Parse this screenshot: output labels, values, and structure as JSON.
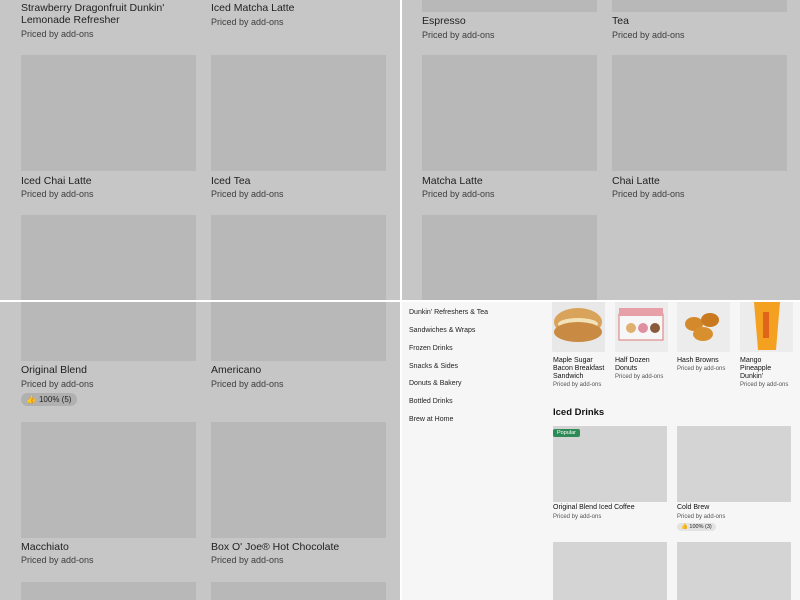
{
  "q1": {
    "items": [
      {
        "name": "Strawberry Dragonfruit Dunkin' Lemonade Refresher",
        "price": "Priced by add-ons"
      },
      {
        "name": "Iced Matcha Latte",
        "price": "Priced by add-ons"
      },
      {
        "name": "Iced Chai Latte",
        "price": "Priced by add-ons"
      },
      {
        "name": "Iced Tea",
        "price": "Priced by add-ons"
      }
    ]
  },
  "q2": {
    "items": [
      {
        "name": "Espresso",
        "price": "Priced by add-ons"
      },
      {
        "name": "Tea",
        "price": "Priced by add-ons"
      },
      {
        "name": "Matcha Latte",
        "price": "Priced by add-ons"
      },
      {
        "name": "Chai Latte",
        "price": "Priced by add-ons"
      }
    ]
  },
  "q3": {
    "items": [
      {
        "name": "Original Blend",
        "price": "Priced by add-ons",
        "rating": "100% (5)"
      },
      {
        "name": "Americano",
        "price": "Priced by add-ons"
      },
      {
        "name": "Macchiato",
        "price": "Priced by add-ons"
      },
      {
        "name": "Box O' Joe® Hot Chocolate",
        "price": "Priced by add-ons"
      }
    ]
  },
  "q4": {
    "nav": [
      "Dunkin' Refreshers & Tea",
      "Sandwiches & Wraps",
      "Frozen Drinks",
      "Snacks & Sides",
      "Donuts & Bakery",
      "Bottled Drinks",
      "Brew at Home"
    ],
    "featured": [
      {
        "name": "Maple Sugar Bacon Breakfast Sandwich",
        "price": "Priced by add-ons"
      },
      {
        "name": "Half Dozen Donuts",
        "price": "Priced by add-ons"
      },
      {
        "name": "Hash Browns",
        "price": "Priced by add-ons"
      },
      {
        "name": "Mango Pineapple Dunkin'",
        "price": "Priced by add-ons"
      }
    ],
    "section_title": "Iced Drinks",
    "badge": "Popular",
    "iced": [
      {
        "name": "Original Blend Iced Coffee",
        "price": "Priced by add-ons"
      },
      {
        "name": "Cold Brew",
        "price": "Priced by add-ons",
        "rating": "100% (3)"
      }
    ],
    "colors": {
      "badge": "#2e8b57"
    }
  }
}
